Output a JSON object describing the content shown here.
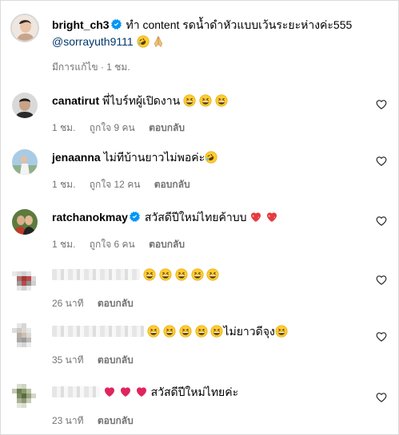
{
  "post": {
    "username": "bright_ch3",
    "caption": "ทำ content รดน้ำดำหัวแบบเว้นระยะห่างค่ะ555",
    "mention": "@sorrayuth9111",
    "edited_label": "มีการแก้ไข · 1 ชม."
  },
  "comments": [
    {
      "username": "canatirut",
      "verified": false,
      "text": "พี่ไบร์ทผู้เปิดงาน",
      "emoji_count": 3,
      "time": "1 ชม.",
      "likes": "ถูกใจ 9 คน",
      "reply": "ตอบกลับ"
    },
    {
      "username": "jenaanna",
      "verified": false,
      "text": "ไม่ทีบ้านยาวไม่พอค่ะ",
      "time": "1 ชม.",
      "likes": "ถูกใจ 12 คน",
      "reply": "ตอบกลับ"
    },
    {
      "username": "ratchanokmay",
      "verified": true,
      "text": "สวัสดีปีใหม่ไทยค้าบบ",
      "time": "1 ชม.",
      "likes": "ถูกใจ 6 คน",
      "reply": "ตอบกลับ"
    },
    {
      "username": "",
      "text": "",
      "time": "26 นาที",
      "reply": "ตอบกลับ"
    },
    {
      "username": "",
      "text": "ไม่ยาวดีจุง",
      "time": "35 นาที",
      "reply": "ตอบกลับ"
    },
    {
      "username": "",
      "text": "สวัสดีปีใหม่ไทยค่ะ",
      "time": "23 นาที",
      "reply": "ตอบกลับ"
    }
  ],
  "icons": {
    "like": "heart-outline-icon",
    "verified": "verified-badge-icon"
  },
  "colors": {
    "meta": "#737373",
    "mention": "#00376b",
    "verified": "#0095f6",
    "heart_red": "#e0245e"
  }
}
